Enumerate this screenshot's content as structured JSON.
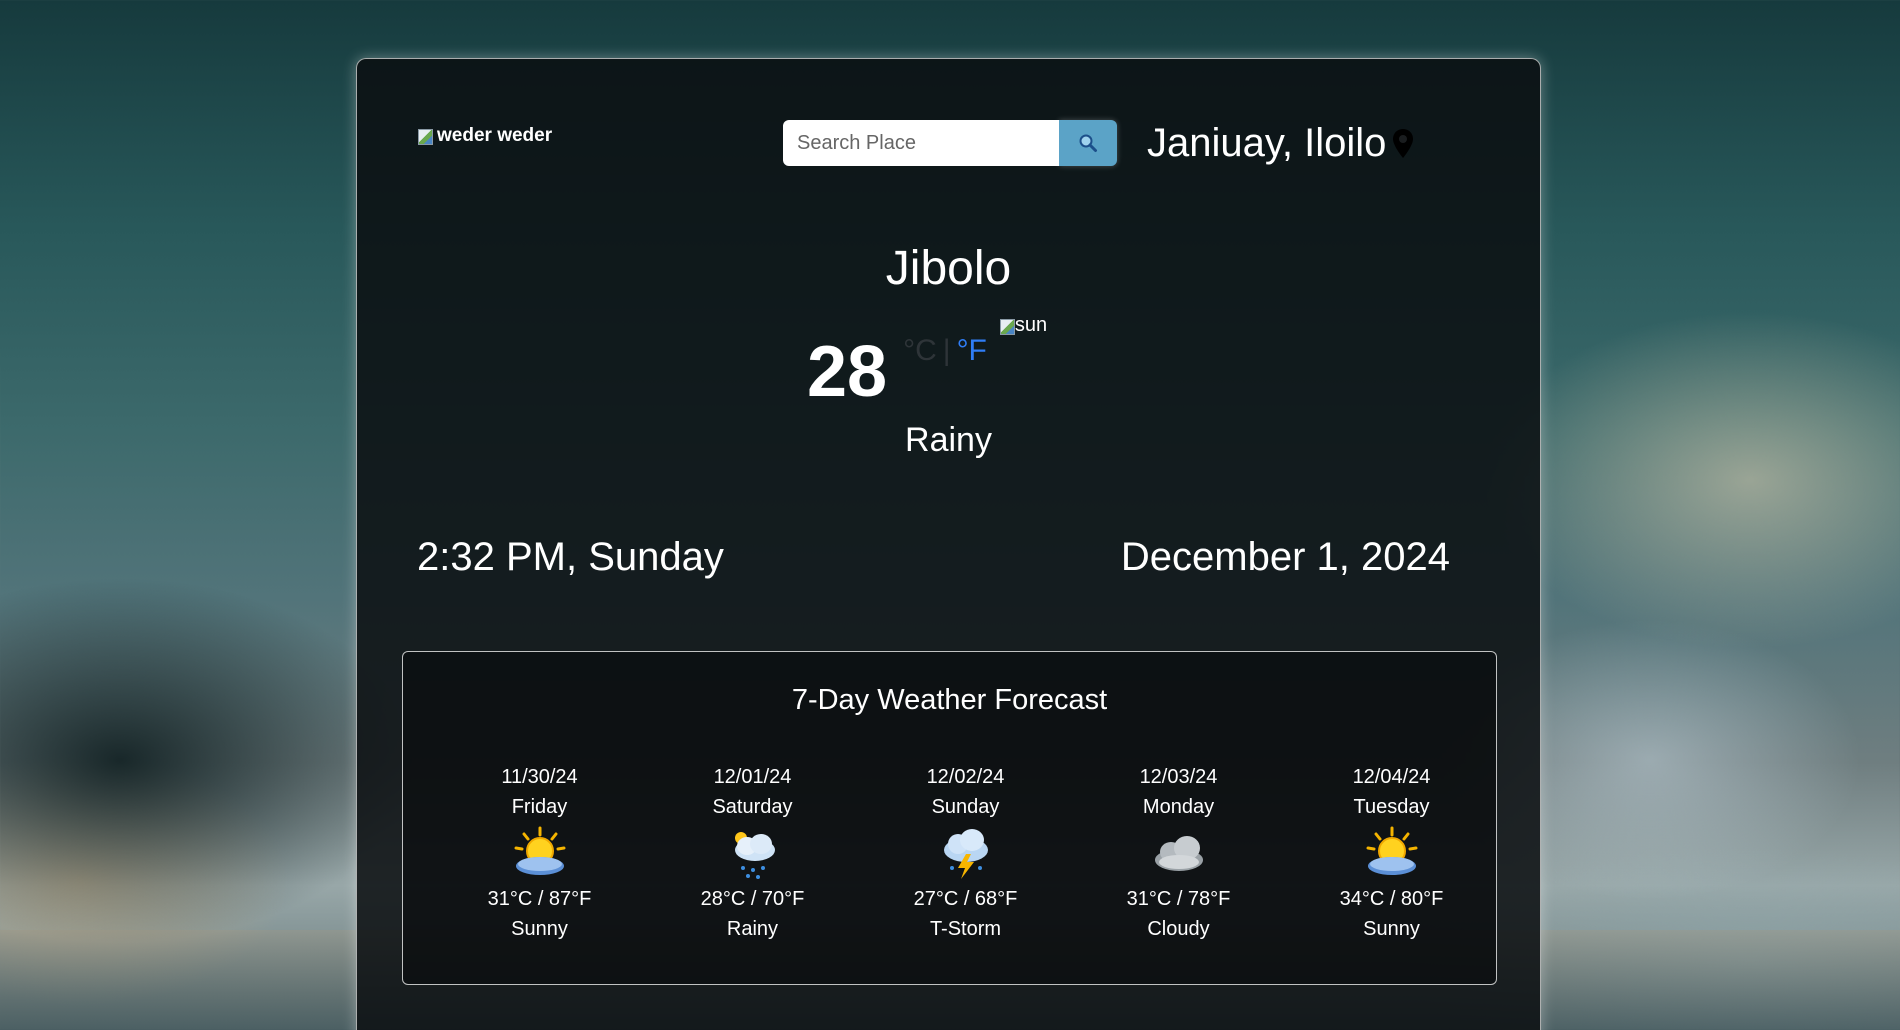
{
  "app": {
    "logo_alt": "weder weder",
    "search_placeholder": "Search Place",
    "location": "Janiuay, Iloilo"
  },
  "current": {
    "city": "Jibolo",
    "temperature": "28",
    "unit_c": "°C",
    "unit_sep": "|",
    "unit_f": "°F",
    "icon_alt": "sun",
    "condition": "Rainy",
    "time": "2:32 PM, Sunday",
    "date": "December 1, 2024"
  },
  "forecast": {
    "title": "7-Day Weather Forecast",
    "days": [
      {
        "date": "11/30/24",
        "weekday": "Friday",
        "temps": "31°C / 87°F",
        "condition": "Sunny",
        "icon": "sun-cloud-icon"
      },
      {
        "date": "12/01/24",
        "weekday": "Saturday",
        "temps": "28°C / 70°F",
        "condition": "Rainy",
        "icon": "rain-cloud-icon"
      },
      {
        "date": "12/02/24",
        "weekday": "Sunday",
        "temps": "27°C / 68°F",
        "condition": "T-Storm",
        "icon": "thunderstorm-icon"
      },
      {
        "date": "12/03/24",
        "weekday": "Monday",
        "temps": "31°C / 78°F",
        "condition": "Cloudy",
        "icon": "cloud-icon"
      },
      {
        "date": "12/04/24",
        "weekday": "Tuesday",
        "temps": "34°C / 80°F",
        "condition": "Sunny",
        "icon": "sun-cloud-icon"
      }
    ]
  },
  "colors": {
    "unit_active": "#2f7df6",
    "search_button": "#5ba3c7"
  }
}
